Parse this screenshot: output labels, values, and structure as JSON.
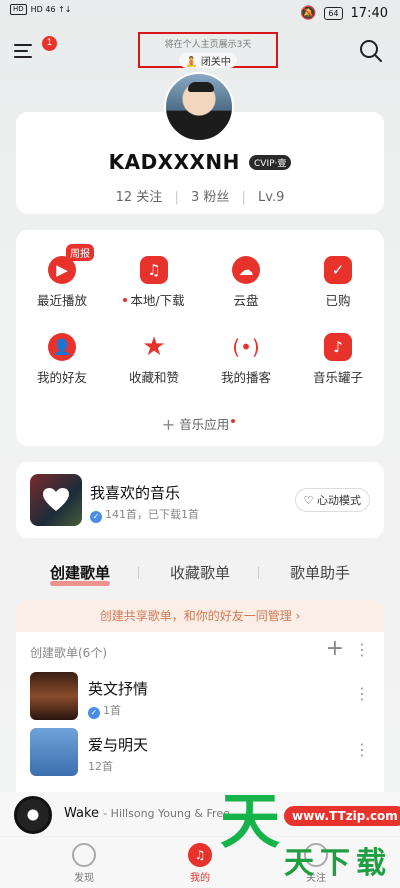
{
  "status_bar": {
    "left": "HD 46 ↑↓",
    "battery": "64",
    "time": "17:40"
  },
  "topbar": {
    "badge_count": "1",
    "notice_line1": "将在个人主页展示3天",
    "notice_line2": "闭关中"
  },
  "profile": {
    "username": "KADXXXNH",
    "vip_label": "CVIP·壹",
    "following": "12 关注",
    "followers": "3 粉丝",
    "level": "Lv.9"
  },
  "apps": {
    "weekly_tag": "周报",
    "items": [
      {
        "label": "最近播放",
        "icon": "play-icon"
      },
      {
        "label": "本地/下载",
        "icon": "local-music-icon"
      },
      {
        "label": "云盘",
        "icon": "cloud-icon"
      },
      {
        "label": "已购",
        "icon": "bag-icon"
      },
      {
        "label": "我的好友",
        "icon": "friends-icon"
      },
      {
        "label": "收藏和赞",
        "icon": "star-icon"
      },
      {
        "label": "我的播客",
        "icon": "podcast-icon"
      },
      {
        "label": "音乐罐子",
        "icon": "jar-icon"
      }
    ],
    "music_apps_label": "音乐应用"
  },
  "favorites": {
    "title": "我喜欢的音乐",
    "subtitle": "141首，已下载1首",
    "heart_mode_label": "心动模式"
  },
  "tabs": [
    "创建歌单",
    "收藏歌单",
    "歌单助手"
  ],
  "share_banner": "创建共享歌单，和你的好友一同管理 ›",
  "playlists": {
    "header": "创建歌单(6个)",
    "items": [
      {
        "title": "英文抒情",
        "count": "1首"
      },
      {
        "title": "爱与明天",
        "count": "12首"
      }
    ]
  },
  "mini_player": {
    "title": "Wake",
    "artist": "- Hillsong Young & Free"
  },
  "bottom_nav": [
    {
      "label": "发现"
    },
    {
      "label": "我的"
    },
    {
      "label": "关注"
    }
  ],
  "watermark": {
    "char": "天",
    "url": "www.TTzip.com",
    "sub": "天下载"
  },
  "colors": {
    "accent": "#e8332c",
    "highlight_box": "#d9161a"
  }
}
